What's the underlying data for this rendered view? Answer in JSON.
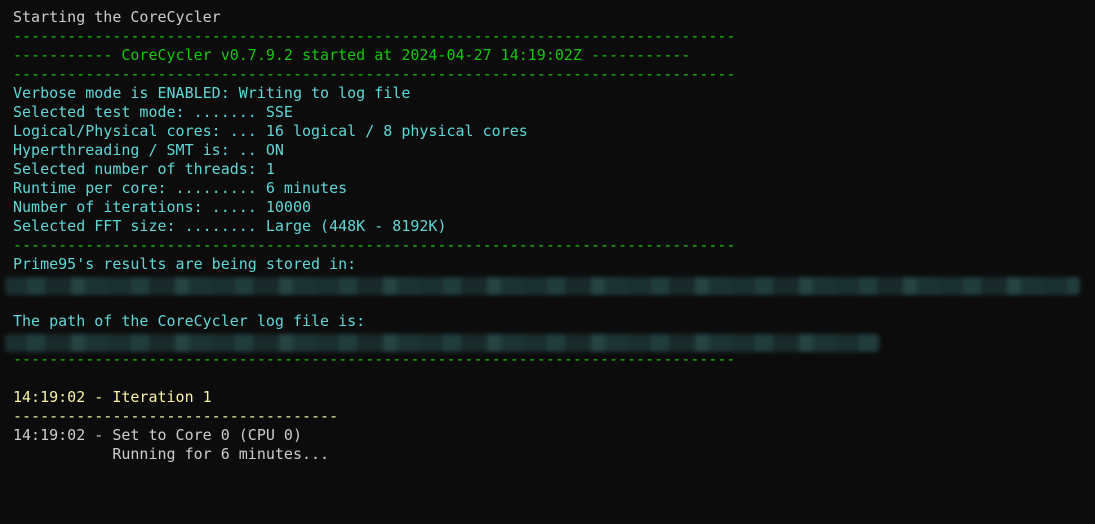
{
  "terminal": {
    "lines": {
      "l0": "Starting the CoreCycler",
      "l1": "--------------------------------------------------------------------------------",
      "l2": "----------- CoreCycler v0.7.9.2 started at 2024-04-27 14:19:02Z -----------",
      "l3": "--------------------------------------------------------------------------------",
      "l4": "Verbose mode is ENABLED: Writing to log file",
      "l5": "Selected test mode: ....... SSE",
      "l6": "Logical/Physical cores: ... 16 logical / 8 physical cores",
      "l7": "Hyperthreading / SMT is: .. ON",
      "l8": "Selected number of threads: 1",
      "l9": "Runtime per core: ......... 6 minutes",
      "l10": "Number of iterations: ..... 10000",
      "l11": "Selected FFT size: ........ Large (448K - 8192K)",
      "l12": "--------------------------------------------------------------------------------",
      "l13": "Prime95's results are being stored in:",
      "l15": "The path of the CoreCycler log file is:",
      "l17": "--------------------------------------------------------------------------------",
      "l19": "14:19:02 - Iteration 1",
      "l20": "------------------------------------",
      "l21": "14:19:02 - Set to Core 0 (CPU 0)",
      "l22": "           Running for 6 minutes..."
    },
    "colors": {
      "background": "#0c0c0c",
      "white": "#cccccc",
      "green": "#16c60c",
      "cyan": "#61d6d6",
      "yellow": "#f9f1a5"
    }
  }
}
